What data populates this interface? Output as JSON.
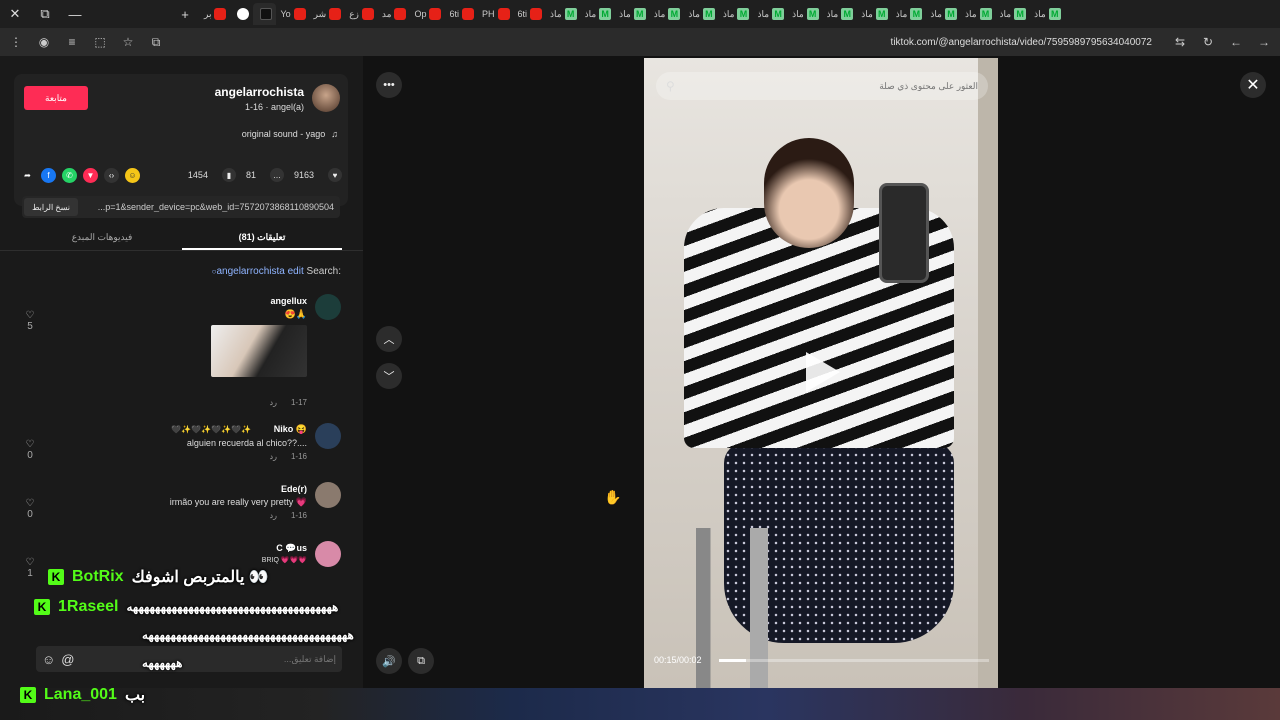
{
  "browser": {
    "tabs": [
      {
        "label": "بر",
        "icon": "youtube-icon"
      },
      {
        "label": "",
        "icon": "google-icon"
      },
      {
        "label": "",
        "icon": "tiktok-icon",
        "active": true
      },
      {
        "label": "Yo",
        "icon": "youtube-icon"
      },
      {
        "label": "شر",
        "icon": "youtube-icon"
      },
      {
        "label": "زع",
        "icon": "youtube-icon"
      },
      {
        "label": "مد",
        "icon": "youtube-icon"
      },
      {
        "label": "Op",
        "icon": "youtube-icon"
      },
      {
        "label": "6ti",
        "icon": "youtube-icon"
      },
      {
        "label": "PH",
        "icon": "youtube-icon"
      },
      {
        "label": "6ti",
        "icon": "youtube-icon"
      },
      {
        "label": "ماذ",
        "icon": "m-icon"
      },
      {
        "label": "ماذ",
        "icon": "m-icon"
      },
      {
        "label": "ماذ",
        "icon": "m-icon"
      },
      {
        "label": "ماذ",
        "icon": "m-icon"
      },
      {
        "label": "ماذ",
        "icon": "m-icon"
      },
      {
        "label": "ماذ",
        "icon": "m-icon"
      },
      {
        "label": "ماذ",
        "icon": "m-icon"
      },
      {
        "label": "ماذ",
        "icon": "m-icon"
      },
      {
        "label": "ماذ",
        "icon": "m-icon"
      },
      {
        "label": "ماذ",
        "icon": "m-icon"
      },
      {
        "label": "ماذ",
        "icon": "m-icon"
      },
      {
        "label": "ماذ",
        "icon": "m-icon"
      },
      {
        "label": "ماذ",
        "icon": "m-icon"
      },
      {
        "label": "ماذ",
        "icon": "m-icon"
      },
      {
        "label": "ماذ",
        "icon": "m-icon"
      }
    ],
    "url": "tiktok.com/@angelarrochista/video/7595989795634040072"
  },
  "author": {
    "follow_label": "متابعة",
    "name": "angelarrochista",
    "sub": "1-16 · angel(a)",
    "sound": "original sound - yago"
  },
  "stats": {
    "likes": "9163",
    "comments": "81",
    "saves": "1454"
  },
  "link": {
    "copy_label": "نسخ الرابط",
    "text": "...p=1&sender_device=pc&web_id=7572073868110890504"
  },
  "tabs": {
    "comments": "(81) تعليقات",
    "creator_videos": "فيديوهات المبدع"
  },
  "search": {
    "prefix": "Search:",
    "query": "angelarrochista edit"
  },
  "comments": [
    {
      "name": "angellux",
      "text": "😍🙏",
      "date": "1-17",
      "reply": "رد",
      "likes": "5"
    },
    {
      "name": "Niko 😝",
      "text": "alguien recuerda al chico??....",
      "emoji": "🖤✨🖤✨🖤✨🖤✨",
      "date": "1-16",
      "reply": "رد",
      "likes": "0"
    },
    {
      "name": "Ede(r)",
      "text": "irmão you are really very pretty 💗",
      "date": "1-16",
      "reply": "رد",
      "likes": "0"
    },
    {
      "name": "C 💬us",
      "text": "BRIQ 💗💗💗",
      "likes": "1"
    }
  ],
  "comment_input": {
    "placeholder": "...إضافة تعليق"
  },
  "video": {
    "search_placeholder": "العثور على محتوى ذي صلة",
    "time": "00:15/00:02",
    "progress": 0.1
  },
  "stream_chat": [
    {
      "user": "BotRix",
      "msg": "يالمتربص اشوفك 👀"
    },
    {
      "user": "1Raseel",
      "msg": "هههههههههههههههههههههههههههههههههههههه"
    },
    {
      "user": "",
      "msg": "هههههههههههههههههههههههههههههههههههههه"
    },
    {
      "user": "",
      "msg": "ههههههه"
    },
    {
      "user": "Lana_001",
      "msg": "بب"
    }
  ]
}
